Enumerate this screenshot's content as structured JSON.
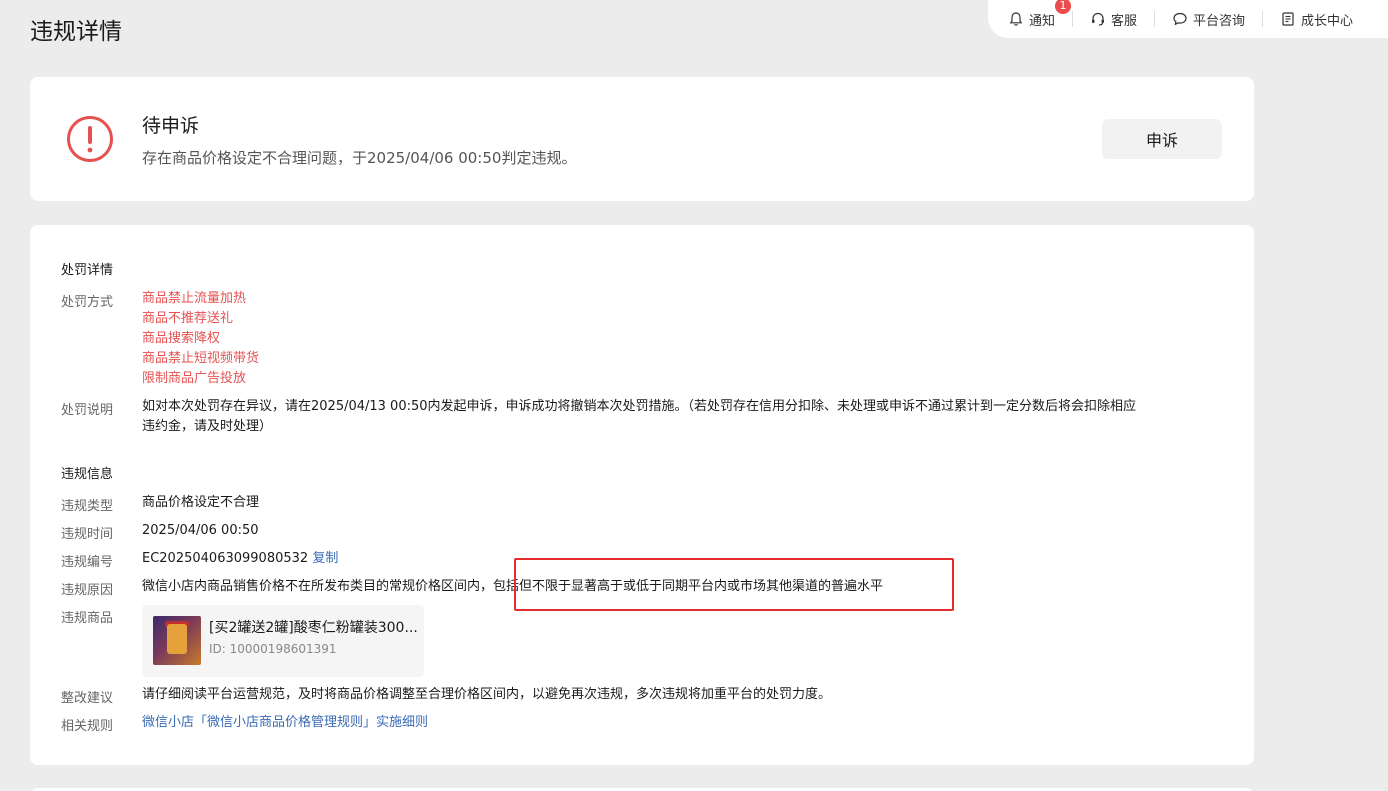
{
  "page": {
    "title": "违规详情"
  },
  "topnav": {
    "items": [
      {
        "label": "通知",
        "icon": "bell-icon",
        "badge": "1"
      },
      {
        "label": "客服",
        "icon": "headset-icon"
      },
      {
        "label": "平台咨询",
        "icon": "chat-bubble-icon"
      },
      {
        "label": "成长中心",
        "icon": "document-icon"
      }
    ]
  },
  "status": {
    "icon": "exclamation-circle-icon",
    "title": "待申诉",
    "description": "存在商品价格设定不合理问题，于2025/04/06 00:50判定违规。",
    "appeal_button": "申诉"
  },
  "penalty": {
    "section_title": "处罚详情",
    "method_label": "处罚方式",
    "methods": [
      "商品禁止流量加热",
      "商品不推荐送礼",
      "商品搜索降权",
      "商品禁止短视频带货",
      "限制商品广告投放"
    ],
    "note_label": "处罚说明",
    "note_line1": "如对本次处罚存在异议，请在2025/04/13 00:50内发起申诉，申诉成功将撤销本次处罚措施。（若处罚存在信用分扣除、未处理或申诉不通过累计到一定分数后将会扣除相应",
    "note_line2": "违约金，请及时处理）"
  },
  "violation": {
    "section_title": "违规信息",
    "type_label": "违规类型",
    "type_value": "商品价格设定不合理",
    "time_label": "违规时间",
    "time_value": "2025/04/06 00:50",
    "id_label": "违规编号",
    "id_value": "EC202504063099080532",
    "copy_label": "复制",
    "reason_label": "违规原因",
    "reason_part1": "微信小店内商品销售价格不在所发布类目的常规价格区间内，",
    "reason_part2": "包括但不限于显著高于或低于同期平台内或市场其他渠道的普遍水平",
    "product_label": "违规商品",
    "product_name": "[买2罐送2罐]酸枣仁粉罐装300...",
    "product_id": "ID: 10000198601391",
    "advice_label": "整改建议",
    "advice_value": "请仔细阅读平台运营规范，及时将商品价格调整至合理价格区间内，以避免再次违规，多次违规将加重平台的处罚力度。",
    "rule_label": "相关规则",
    "rule_link": "微信小店「微信小店商品价格管理规则」实施细则"
  },
  "colors": {
    "accent_red": "#e65252",
    "link_blue": "#3a6bb5",
    "highlight_border": "#e52d2d"
  }
}
